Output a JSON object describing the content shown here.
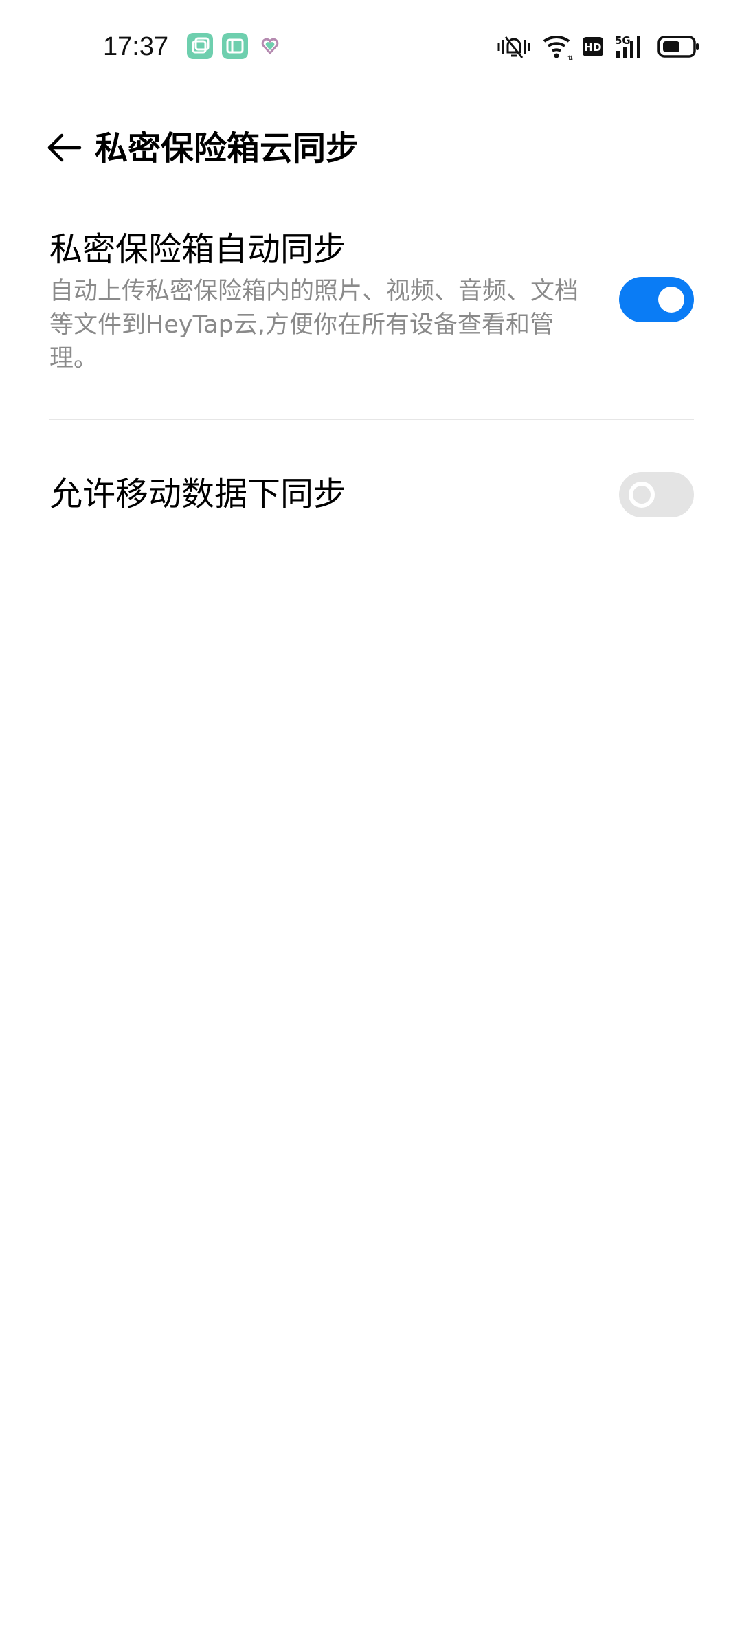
{
  "status_bar": {
    "time": "17:37",
    "notification_icons": [
      "multitask-app-icon",
      "window-app-icon",
      "heart-app-icon"
    ],
    "system_icons": [
      "vibrate-mute-icon",
      "wifi-icon",
      "hd-icon",
      "5g-signal-icon",
      "battery-icon"
    ],
    "hd_label": "HD",
    "network_label": "5G"
  },
  "header": {
    "title": "私密保险箱云同步"
  },
  "settings": {
    "auto_sync": {
      "title": "私密保险箱自动同步",
      "description": "自动上传私密保险箱内的照片、视频、音频、文档等文件到HeyTap云,方便你在所有设备查看和管理。",
      "enabled": true
    },
    "mobile_data_sync": {
      "title": "允许移动数据下同步",
      "enabled": false
    }
  },
  "colors": {
    "accent": "#0a7cf5",
    "toggle_off": "#e4e4e4",
    "secondary_text": "#8a8a8a",
    "notification_green": "#6ecfae"
  }
}
